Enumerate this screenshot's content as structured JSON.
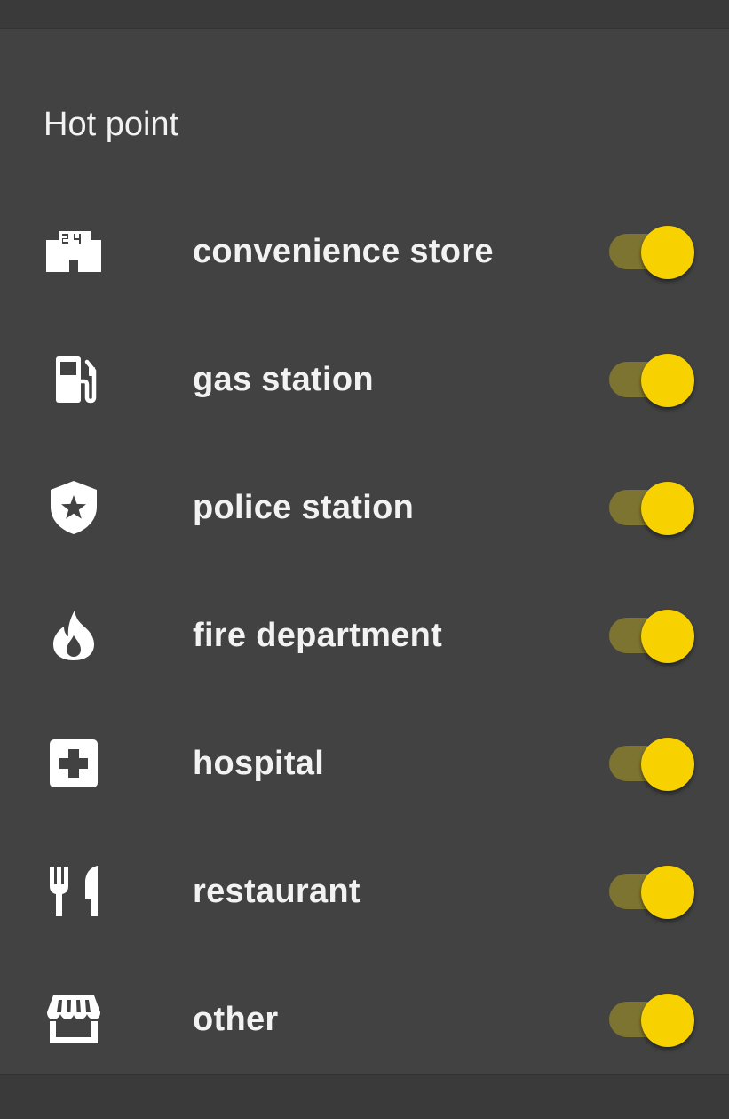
{
  "section": {
    "title": "Hot point"
  },
  "colors": {
    "sheet_background": "#424242",
    "text": "#f2f2f2",
    "switch_thumb_on": "#f7d100",
    "switch_track_on": "#7e7431"
  },
  "items": [
    {
      "label": "convenience store",
      "icon": "convenience-store-24-icon",
      "enabled": true
    },
    {
      "label": "gas station",
      "icon": "gas-pump-icon",
      "enabled": true
    },
    {
      "label": "police station",
      "icon": "police-shield-icon",
      "enabled": true
    },
    {
      "label": "fire department",
      "icon": "flame-icon",
      "enabled": true
    },
    {
      "label": "hospital",
      "icon": "hospital-cross-icon",
      "enabled": true
    },
    {
      "label": "restaurant",
      "icon": "fork-knife-icon",
      "enabled": true
    },
    {
      "label": "other",
      "icon": "storefront-icon",
      "enabled": true
    }
  ]
}
